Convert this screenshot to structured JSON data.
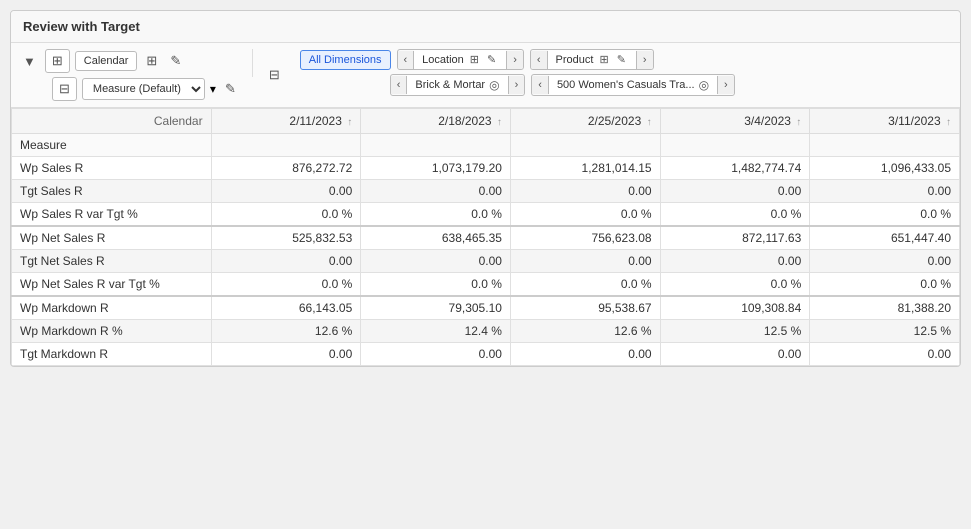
{
  "title": "Review with Target",
  "toolbar": {
    "collapse_icon": "▼",
    "expand_icon": "⊞",
    "calendar_label": "Calendar",
    "hierarchy_icon": "⊞",
    "edit_icon": "✎",
    "column_icon": "⊟",
    "measure_label": "Measure (Default)",
    "pencil_icon": "✎",
    "chevron_down": "▾",
    "layout_icon": "⊟",
    "all_dimensions_label": "All Dimensions",
    "location_label": "Location",
    "product_label": "Product",
    "brick_mortar_label": "Brick & Mortar",
    "target_icon": "◎",
    "nav_left": "‹",
    "nav_right": "›",
    "product_value": "500 Women's Casuals Tra...",
    "sort_asc": "↑"
  },
  "table": {
    "header_label": "Calendar",
    "columns": [
      {
        "date": "2/11/2023",
        "sort": "↑"
      },
      {
        "date": "2/18/2023",
        "sort": "↑"
      },
      {
        "date": "2/25/2023",
        "sort": "↑"
      },
      {
        "date": "3/4/2023",
        "sort": "↑"
      },
      {
        "date": "3/11/2023",
        "sort": "↑"
      }
    ],
    "measure_group_label": "Measure",
    "rows": [
      {
        "label": "Wp Sales R",
        "values": [
          "876,272.72",
          "1,073,179.20",
          "1,281,014.15",
          "1,482,774.74",
          "1,096,433.05"
        ],
        "shaded": false
      },
      {
        "label": "Tgt Sales R",
        "values": [
          "0.00",
          "0.00",
          "0.00",
          "0.00",
          "0.00"
        ],
        "shaded": true
      },
      {
        "label": "Wp Sales R var Tgt %",
        "values": [
          "0.0 %",
          "0.0 %",
          "0.0 %",
          "0.0 %",
          "0.0 %"
        ],
        "shaded": false
      },
      {
        "label": "",
        "values": [
          "",
          "",
          "",
          "",
          ""
        ],
        "shaded": false,
        "separator": true
      },
      {
        "label": "Wp Net Sales R",
        "values": [
          "525,832.53",
          "638,465.35",
          "756,623.08",
          "872,117.63",
          "651,447.40"
        ],
        "shaded": false
      },
      {
        "label": "Tgt Net Sales R",
        "values": [
          "0.00",
          "0.00",
          "0.00",
          "0.00",
          "0.00"
        ],
        "shaded": true
      },
      {
        "label": "Wp Net Sales R var Tgt %",
        "values": [
          "0.0 %",
          "0.0 %",
          "0.0 %",
          "0.0 %",
          "0.0 %"
        ],
        "shaded": false
      },
      {
        "label": "",
        "values": [
          "",
          "",
          "",
          "",
          ""
        ],
        "shaded": false,
        "separator": true
      },
      {
        "label": "Wp Markdown R",
        "values": [
          "66,143.05",
          "79,305.10",
          "95,538.67",
          "109,308.84",
          "81,388.20"
        ],
        "shaded": false
      },
      {
        "label": "Wp Markdown R %",
        "values": [
          "12.6 %",
          "12.4 %",
          "12.6 %",
          "12.5 %",
          "12.5 %"
        ],
        "shaded": true
      },
      {
        "label": "Tgt Markdown R",
        "values": [
          "0.00",
          "0.00",
          "0.00",
          "0.00",
          "0.00"
        ],
        "shaded": false
      }
    ]
  }
}
